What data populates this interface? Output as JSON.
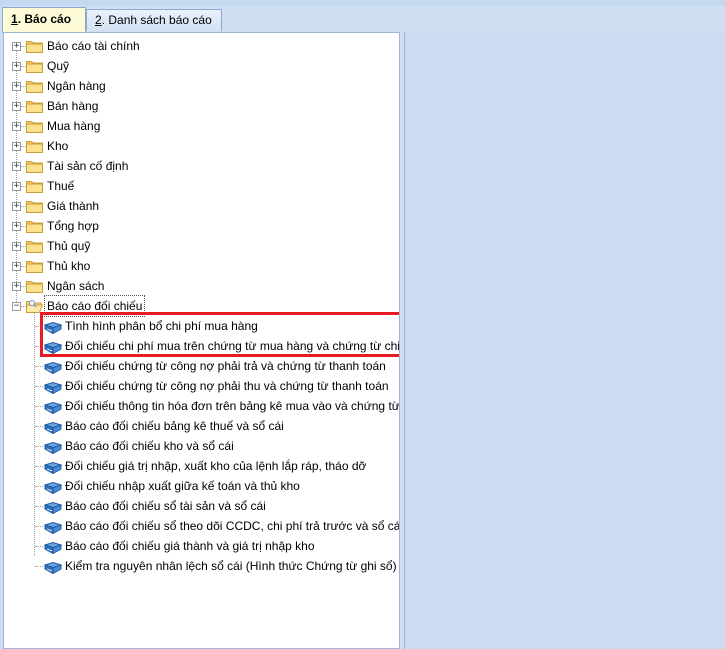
{
  "tabs": [
    {
      "key": "1",
      "label": ". Báo cáo"
    },
    {
      "key": "2",
      "label": ". Danh sách báo cáo"
    }
  ],
  "tree": {
    "folders": [
      {
        "label": "Báo cáo tài chính"
      },
      {
        "label": "Quỹ"
      },
      {
        "label": "Ngân hàng"
      },
      {
        "label": "Bán hàng"
      },
      {
        "label": "Mua hàng"
      },
      {
        "label": "Kho"
      },
      {
        "label": "Tài sản cố định"
      },
      {
        "label": "Thuế"
      },
      {
        "label": "Giá thành"
      },
      {
        "label": "Tổng hợp"
      },
      {
        "label": "Thủ quỹ"
      },
      {
        "label": "Thủ kho"
      },
      {
        "label": "Ngân sách"
      }
    ],
    "open_folder": {
      "label": "Báo cáo đối chiếu",
      "children": [
        {
          "label": "Tình hình phân bổ chi phí mua hàng"
        },
        {
          "label": "Đối chiếu chi phí mua trên chứng từ mua hàng và chứng từ chi phí"
        },
        {
          "label": "Đối chiếu chứng từ công nợ phải trả và chứng từ thanh toán"
        },
        {
          "label": "Đối chiếu chứng từ công nợ phải thu và chứng từ thanh toán"
        },
        {
          "label": "Đối chiếu thông tin hóa đơn trên bảng kê mua vào và chứng từ"
        },
        {
          "label": "Báo cáo đối chiếu bảng kê thuế và sổ cái"
        },
        {
          "label": "Báo cáo đối chiếu kho và sổ cái"
        },
        {
          "label": "Đối chiếu giá trị nhập, xuất kho của lệnh lắp ráp, tháo dỡ"
        },
        {
          "label": "Đối chiếu nhập xuất giữa kế toán và thủ kho"
        },
        {
          "label": "Báo cáo đối chiếu sổ tài sản và sổ cái"
        },
        {
          "label": "Báo cáo đối chiếu sổ theo dõi CCDC, chi phí trả trước và sổ cái"
        },
        {
          "label": "Báo cáo đối chiếu giá thành và giá trị nhập kho"
        },
        {
          "label": "Kiểm tra nguyên nhân lệch sổ cái (Hình thức Chứng từ ghi sổ)"
        }
      ]
    }
  },
  "colors": {
    "highlight": "#e81b23",
    "active_tab": "#fefcd8"
  }
}
